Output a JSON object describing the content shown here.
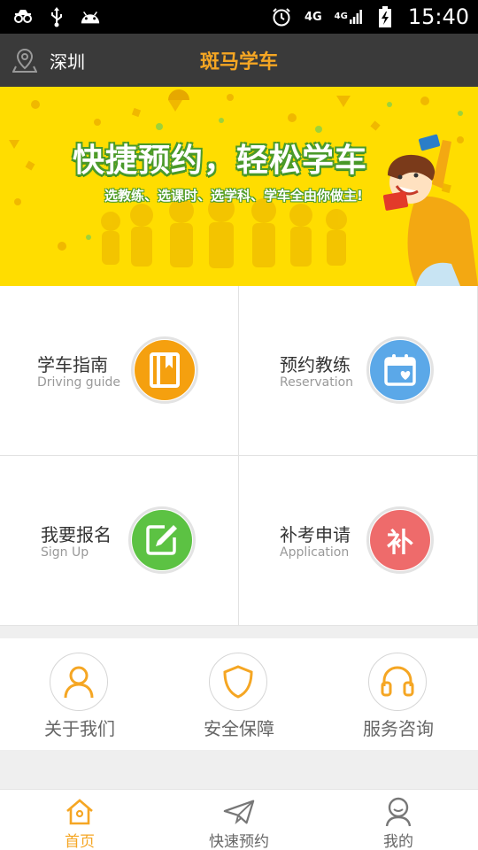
{
  "status_bar": {
    "network": "4G",
    "network2": "4G",
    "time": "15:40"
  },
  "header": {
    "city": "深圳",
    "title": "斑马学车"
  },
  "banner": {
    "headline": "快捷预约，轻松学车",
    "subline": "选教练、选课时、选学科、学车全由你做主!"
  },
  "grid": [
    {
      "cn": "学车指南",
      "en": "Driving guide",
      "color": "#f5a00f",
      "icon": "book-icon"
    },
    {
      "cn": "预约教练",
      "en": "Reservation",
      "color": "#5ba8e8",
      "icon": "calendar-icon"
    },
    {
      "cn": "我要报名",
      "en": "Sign Up",
      "color": "#5cc243",
      "icon": "edit-icon"
    },
    {
      "cn": "补考申请",
      "en": "Application",
      "color": "#ee6b6b",
      "icon": "makeup-exam-icon",
      "glyph": "补"
    }
  ],
  "shortcuts": [
    {
      "label": "关于我们",
      "icon": "person-icon"
    },
    {
      "label": "安全保障",
      "icon": "shield-icon"
    },
    {
      "label": "服务咨询",
      "icon": "headphones-icon"
    }
  ],
  "tabs": [
    {
      "label": "首页",
      "icon": "home-icon",
      "active": true
    },
    {
      "label": "快速预约",
      "icon": "paper-plane-icon",
      "active": false
    },
    {
      "label": "我的",
      "icon": "user-icon",
      "active": false
    }
  ],
  "colors": {
    "accent": "#f5a623",
    "title_bar": "#3a3a3a",
    "banner_bg": "#ffdd00"
  }
}
